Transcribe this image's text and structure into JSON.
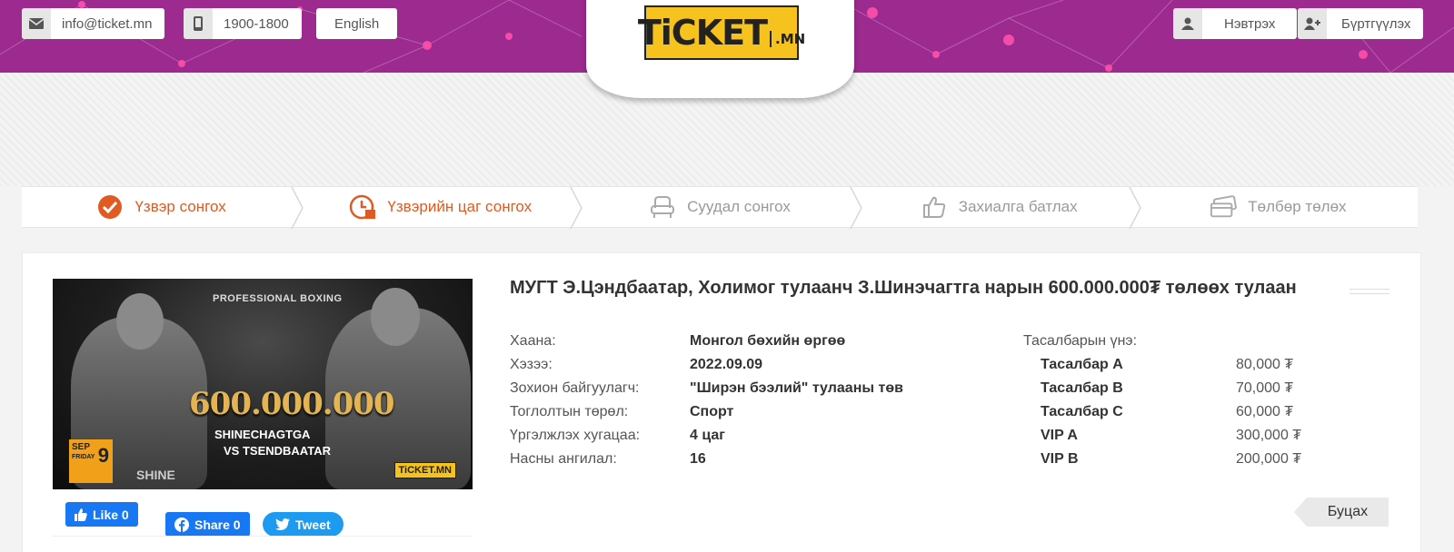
{
  "header": {
    "email": "info@ticket.mn",
    "phone": "1900-1800",
    "language": "English",
    "login": "Нэвтрэх",
    "register": "Бүртгүүлэх",
    "logo_main": "TiCKET",
    "logo_suffix": ".MN"
  },
  "colors": {
    "header_bg": "#9c2a8f",
    "accent": "#e05a22",
    "logo_yellow": "#f6c21d"
  },
  "steps": [
    {
      "label": "Үзвэр сонгох",
      "icon": "check-circle-icon",
      "active": true
    },
    {
      "label": "Үзвэрийн цаг сонгох",
      "icon": "clock-calendar-icon",
      "active": true
    },
    {
      "label": "Суудал сонгох",
      "icon": "seat-icon",
      "active": false
    },
    {
      "label": "Захиалга батлах",
      "icon": "thumbs-up-icon",
      "active": false
    },
    {
      "label": "Төлбөр төлөх",
      "icon": "credit-card-icon",
      "active": false
    }
  ],
  "event": {
    "title": "МУГТ Э.Цэндбаатар, Холимог тулаанч З.Шинэчагтга нарын 600.000.000₮ төлөөх тулаан",
    "poster": {
      "heading": "PROFESSIONAL BOXING",
      "prize": "600.000.000",
      "fighter_a": "SHINECHAGTGA",
      "fighter_b": "VS TSENDBAATAR",
      "month": "SEP",
      "weekday": "FRIDAY",
      "day": "9",
      "brand": "TiCKET.MN",
      "trunks": "SHINE"
    },
    "details": [
      {
        "label": "Хаана:",
        "value": "Монгол бөхийн өргөө"
      },
      {
        "label": "Хэзээ:",
        "value": "2022.09.09"
      },
      {
        "label": "Зохион байгуулагч:",
        "value": "\"Ширэн бээлий\" тулааны төв"
      },
      {
        "label": "Тоглолтын төрөл:",
        "value": "Спорт"
      },
      {
        "label": "Үргэлжлэх хугацаа:",
        "value": "4 цаг"
      },
      {
        "label": "Насны ангилал:",
        "value": "16"
      }
    ],
    "prices_heading": "Тасалбарын үнэ:",
    "prices": [
      {
        "name": "Тасалбар A",
        "price": "80,000 ₮"
      },
      {
        "name": "Тасалбар B",
        "price": "70,000 ₮"
      },
      {
        "name": "Тасалбар C",
        "price": "60,000 ₮"
      },
      {
        "name": "VIP A",
        "price": "300,000 ₮"
      },
      {
        "name": "VIP B",
        "price": "200,000 ₮"
      }
    ]
  },
  "social": {
    "like": "Like 0",
    "share": "Share 0",
    "tweet": "Tweet"
  },
  "back_button": "Буцах"
}
